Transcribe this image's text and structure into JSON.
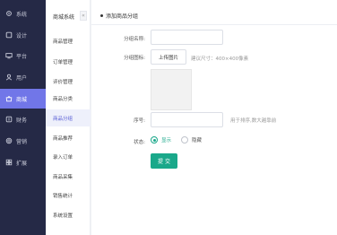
{
  "sidebar": {
    "items": [
      {
        "label": "系统",
        "icon": "settings-icon"
      },
      {
        "label": "设计",
        "icon": "design-icon"
      },
      {
        "label": "平台",
        "icon": "platform-icon"
      },
      {
        "label": "用户",
        "icon": "user-icon"
      },
      {
        "label": "商城",
        "icon": "shop-icon",
        "active": true
      },
      {
        "label": "财务",
        "icon": "finance-icon"
      },
      {
        "label": "营销",
        "icon": "marketing-icon"
      },
      {
        "label": "扩展",
        "icon": "extension-icon"
      }
    ],
    "active_color": "#7176e8",
    "background": "#252946"
  },
  "submenu": {
    "title": "商城系统",
    "collapse_glyph": "«",
    "items": [
      {
        "label": "商品管理"
      },
      {
        "label": "订单管理"
      },
      {
        "label": "评价管理"
      },
      {
        "label": "商品分类"
      },
      {
        "label": "商品分组",
        "active": true
      },
      {
        "label": "商品推荐"
      },
      {
        "label": "录入订单"
      },
      {
        "label": "商品采集"
      },
      {
        "label": "销售统计"
      },
      {
        "label": "系统设置"
      }
    ]
  },
  "main": {
    "title": "添加商品分组",
    "form": {
      "name_label": "分组名称:",
      "name_value": "",
      "icon_label": "分组图标:",
      "upload_label": "上传图片",
      "icon_hint": "建议尺寸：400×400像素",
      "order_label": "序号:",
      "order_value": "",
      "order_hint": "用于排序,数大越靠前",
      "status_label": "状态:",
      "status_options": [
        "显示",
        "隐藏"
      ],
      "status_selected": "显示",
      "submit_label": "提 交"
    },
    "accent_color": "#1aa88a"
  }
}
